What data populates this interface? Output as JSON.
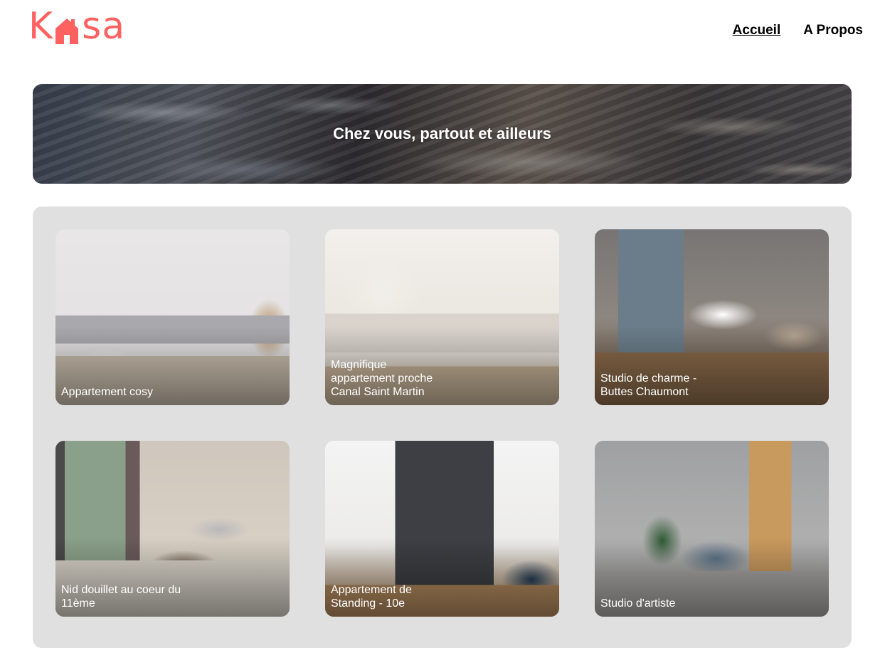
{
  "header": {
    "logo": {
      "letters": [
        "K",
        "s",
        "a"
      ],
      "brand_color": "#FF6060",
      "icon": "house-icon"
    },
    "nav": [
      {
        "label": "Accueil",
        "active": true
      },
      {
        "label": "A Propos",
        "active": false
      }
    ]
  },
  "banner": {
    "title": "Chez vous, partout et ailleurs"
  },
  "gallery": {
    "background_color": "#E0E0E0",
    "cards": [
      {
        "title": "Appartement cosy"
      },
      {
        "title": "Magnifique appartement proche Canal Saint Martin"
      },
      {
        "title": "Studio de charme - Buttes Chaumont"
      },
      {
        "title": "Nid douillet au coeur du 11ème"
      },
      {
        "title": "Appartement de Standing - 10e"
      },
      {
        "title": "Studio d'artiste"
      }
    ]
  }
}
